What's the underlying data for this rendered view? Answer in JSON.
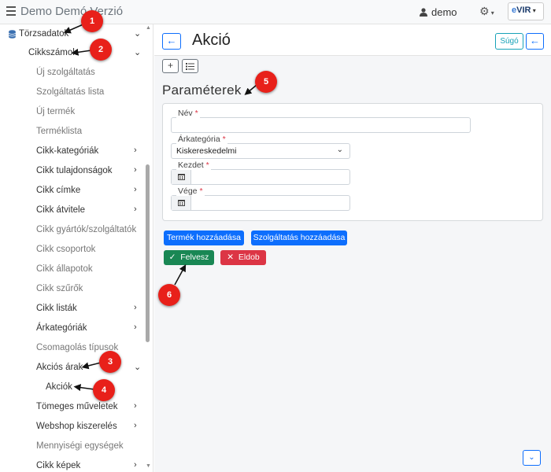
{
  "app": {
    "title": "Demo Demó Verzió",
    "user": "demo",
    "logo_text": "VIR",
    "logo_prefix": "e"
  },
  "sidebar": {
    "items": [
      {
        "label": "Törzsadatok",
        "chevron": "down"
      },
      {
        "label": "Cikkszámok",
        "chevron": "down"
      },
      {
        "label": "Új szolgáltatás"
      },
      {
        "label": "Szolgáltatás lista"
      },
      {
        "label": "Új termék"
      },
      {
        "label": "Terméklista"
      },
      {
        "label": "Cikk-kategóriák",
        "chevron": "right"
      },
      {
        "label": "Cikk tulajdonságok",
        "chevron": "right"
      },
      {
        "label": "Cikk címke",
        "chevron": "right"
      },
      {
        "label": "Cikk átvitele",
        "chevron": "right"
      },
      {
        "label": "Cikk gyártók/szolgáltatók"
      },
      {
        "label": "Cikk csoportok"
      },
      {
        "label": "Cikk állapotok"
      },
      {
        "label": "Cikk szűrők"
      },
      {
        "label": "Cikk listák",
        "chevron": "right"
      },
      {
        "label": "Árkategóriák",
        "chevron": "right"
      },
      {
        "label": "Csomagolás típusok"
      },
      {
        "label": "Akciós árak",
        "chevron": "down"
      },
      {
        "label": "Akciók"
      },
      {
        "label": "Tömeges műveletek",
        "chevron": "right"
      },
      {
        "label": "Webshop kiszerelés",
        "chevron": "right"
      },
      {
        "label": "Mennyiségi egységek"
      },
      {
        "label": "Cikk képek",
        "chevron": "right"
      }
    ]
  },
  "header": {
    "title": "Akció",
    "help_label": "Súgó"
  },
  "section": {
    "title": "Paraméterek"
  },
  "form": {
    "name_label": "Név",
    "price_category_label": "Árkategória",
    "price_category_value": "Kiskereskedelmi",
    "start_label": "Kezdet",
    "end_label": "Vége",
    "required_mark": "*"
  },
  "actions": {
    "add_product": "Termék hozzáadása",
    "add_service": "Szolgáltatás hozzáadása",
    "save": "Felvesz",
    "discard": "Eldob"
  },
  "markers": [
    "1",
    "2",
    "3",
    "4",
    "5",
    "6"
  ],
  "colors": {
    "primary": "#0d6efd",
    "success": "#198754",
    "danger": "#dc3545",
    "marker": "#e8201a"
  }
}
